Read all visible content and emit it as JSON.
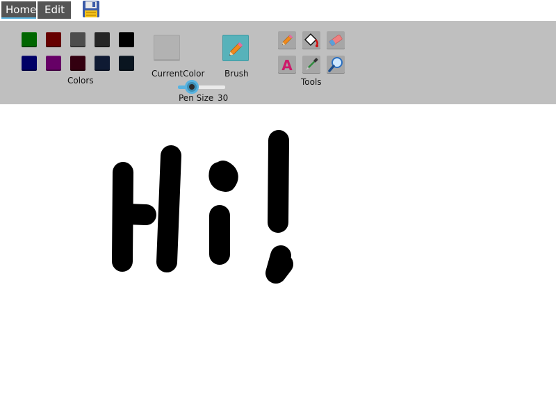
{
  "menu": {
    "tabs": [
      {
        "label": "Home"
      },
      {
        "label": "Edit"
      }
    ]
  },
  "ribbon": {
    "colors": {
      "label": "Colors",
      "swatches": [
        "#006600",
        "#660000",
        "#4d4d4d",
        "#262626",
        "#000000",
        "#000066",
        "#660066",
        "#330010",
        "#0f1a33",
        "#0a1520"
      ]
    },
    "current_color": {
      "label": "CurrentColor",
      "value": "#b2b2b2"
    },
    "brush": {
      "label": "Brush"
    },
    "pen_size": {
      "label": "Pen Size",
      "value": "30",
      "min": 1,
      "max": 100
    },
    "tools": {
      "label": "Tools",
      "items": [
        "pencil-icon",
        "fill-bucket-icon",
        "eraser-icon",
        "text-icon",
        "eyedropper-icon",
        "zoom-icon"
      ]
    }
  },
  "canvas": {
    "background": "#ffffff",
    "stroke_color": "#000000"
  }
}
